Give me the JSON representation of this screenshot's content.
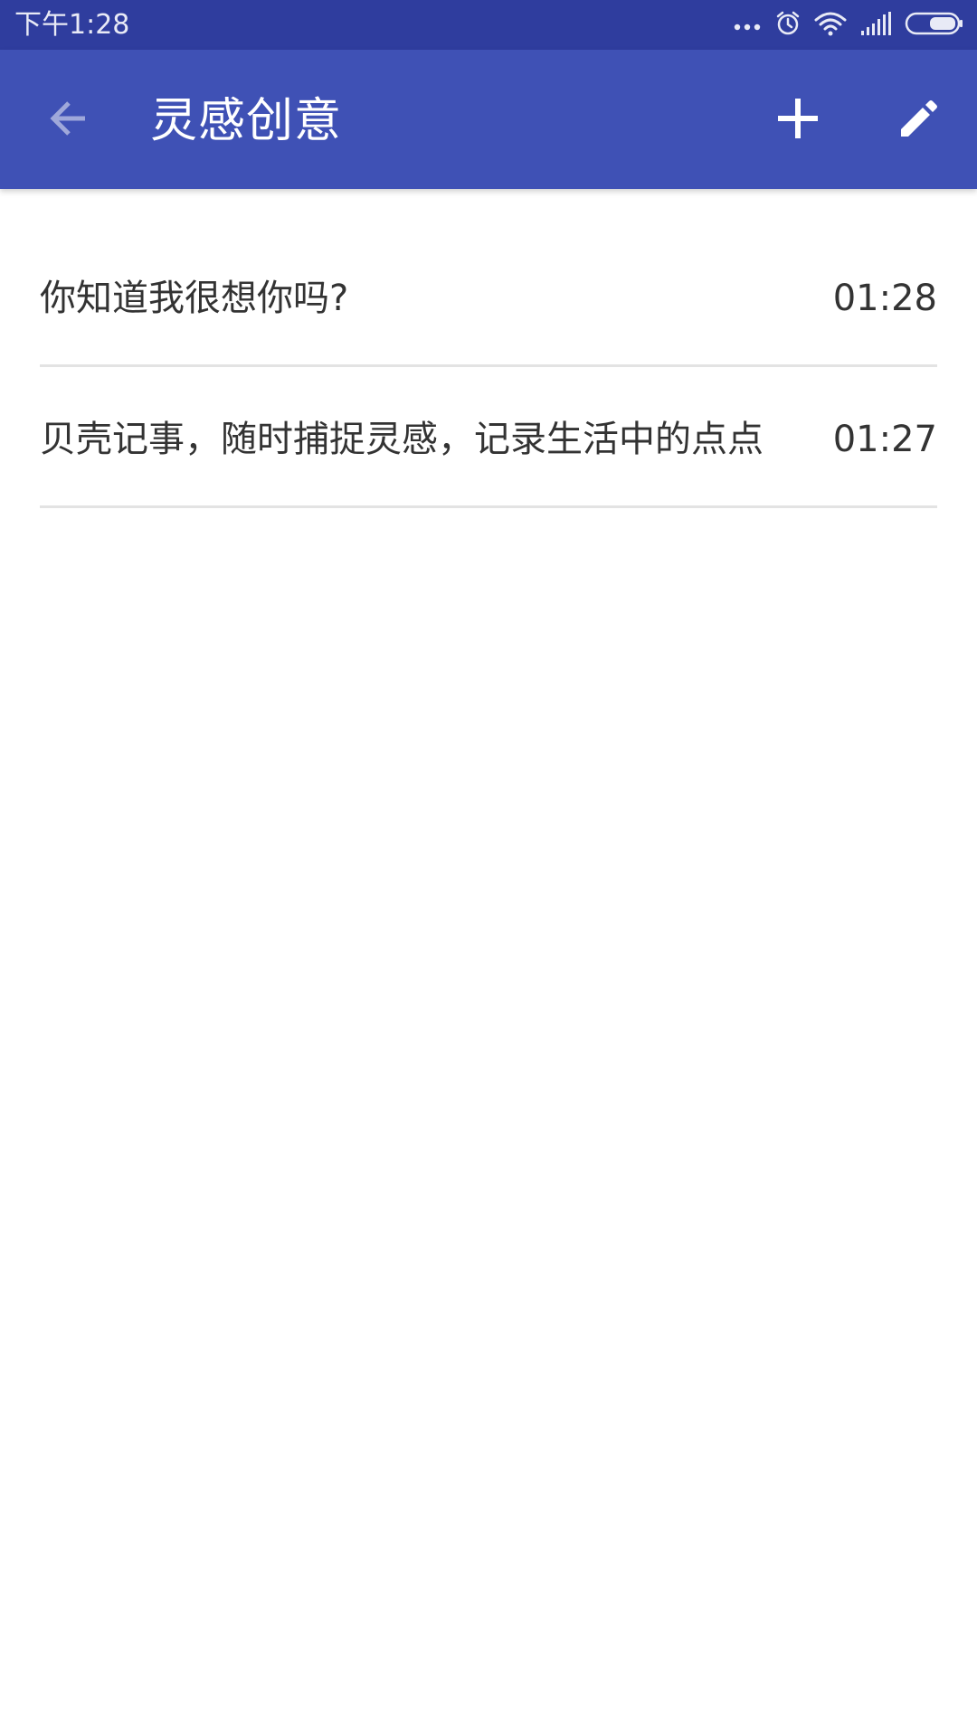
{
  "status_bar": {
    "time": "下午1:28",
    "icons": [
      "more-dots-icon",
      "alarm-icon",
      "wifi-icon",
      "signal-icon",
      "battery-icon"
    ]
  },
  "app_bar": {
    "title": "灵感创意",
    "back_icon": "arrow-back-icon",
    "add_icon": "plus-icon",
    "edit_icon": "pencil-icon",
    "background": "#3f51b5",
    "status_background": "#2f3d9e"
  },
  "notes": [
    {
      "text": "你知道我很想你吗?",
      "time": "01:28"
    },
    {
      "text": "贝壳记事，随时捕捉灵感，记录生活中的点点",
      "time": "01:27"
    }
  ]
}
